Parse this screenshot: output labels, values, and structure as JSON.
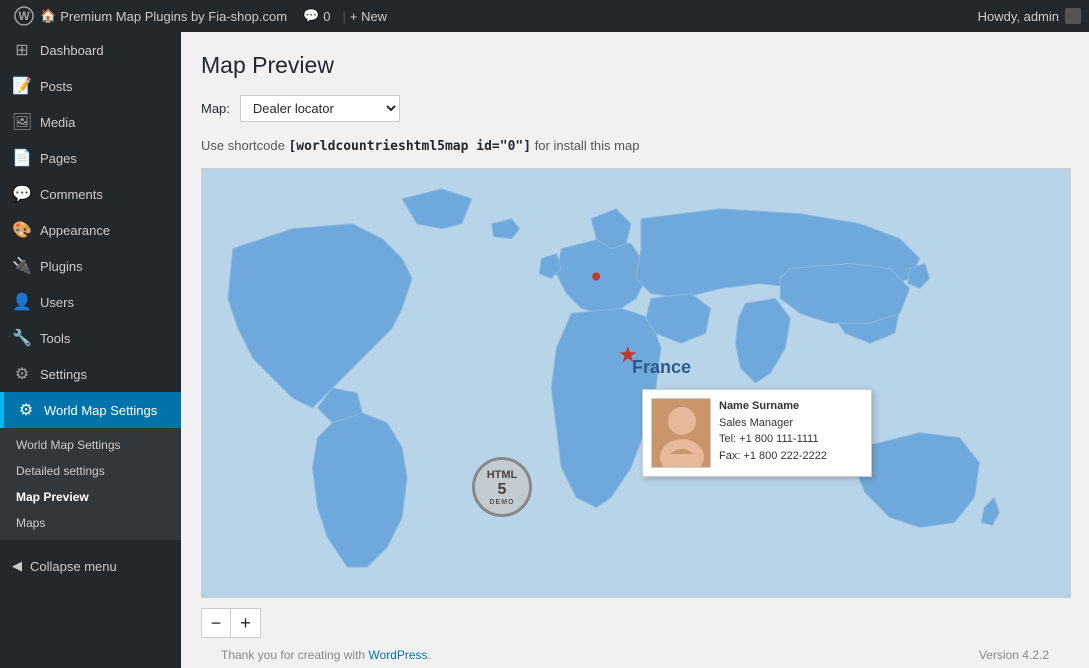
{
  "adminbar": {
    "wp_logo": "W",
    "site_icon": "🏠",
    "site_name": "Premium Map Plugins by Fia-shop.com",
    "comments_icon": "💬",
    "comments_count": "0",
    "new_label": "+ New",
    "howdy_label": "Howdy, admin"
  },
  "sidebar": {
    "menu_items": [
      {
        "id": "dashboard",
        "icon": "⊞",
        "label": "Dashboard"
      },
      {
        "id": "posts",
        "icon": "📝",
        "label": "Posts"
      },
      {
        "id": "media",
        "icon": "🖼",
        "label": "Media"
      },
      {
        "id": "pages",
        "icon": "📄",
        "label": "Pages"
      },
      {
        "id": "comments",
        "icon": "💬",
        "label": "Comments"
      },
      {
        "id": "appearance",
        "icon": "🎨",
        "label": "Appearance"
      },
      {
        "id": "plugins",
        "icon": "🔌",
        "label": "Plugins"
      },
      {
        "id": "users",
        "icon": "👤",
        "label": "Users"
      },
      {
        "id": "tools",
        "icon": "🔧",
        "label": "Tools"
      },
      {
        "id": "settings",
        "icon": "⚙",
        "label": "Settings"
      },
      {
        "id": "worldmap",
        "icon": "⚙",
        "label": "World Map Settings",
        "active": true
      }
    ],
    "submenu": [
      {
        "id": "world-map-settings",
        "label": "World Map Settings"
      },
      {
        "id": "detailed-settings",
        "label": "Detailed settings"
      },
      {
        "id": "map-preview",
        "label": "Map Preview",
        "active": true
      },
      {
        "id": "maps",
        "label": "Maps"
      }
    ],
    "collapse_label": "Collapse menu"
  },
  "main": {
    "page_title": "Map Preview",
    "map_selector_label": "Map:",
    "map_selector_value": "Dealer locator",
    "map_selector_options": [
      "Dealer locator"
    ],
    "shortcode_hint": "Use shortcode [worldcountrieshtml5map id=\"0\"] for install this map",
    "france_label": "France",
    "france_marker": "★",
    "popup": {
      "name": "Name Surname",
      "title": "Sales Manager",
      "tel": "Tel: +1 800 111-1111",
      "fax": "Fax: +1 800 222-2222"
    },
    "html5_stamp_line1": "HTML",
    "html5_stamp_line2": "5",
    "html5_stamp_line3": "DEMO",
    "zoom_minus": "−",
    "zoom_plus": "+"
  },
  "footer": {
    "thank_you": "Thank you for creating with ",
    "wp_link": "WordPress",
    "version": "Version 4.2.2"
  }
}
